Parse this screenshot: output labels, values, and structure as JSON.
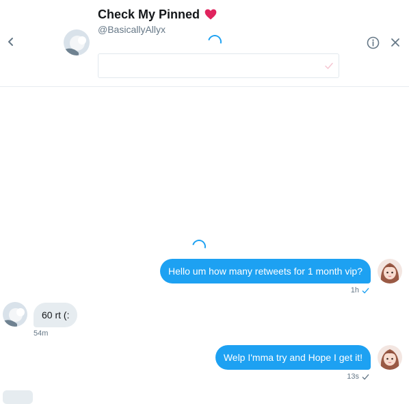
{
  "header": {
    "title": "Check My Pinned",
    "handle": "@BasicallyAllyx",
    "compose": {
      "value": "",
      "placeholder": ""
    }
  },
  "messages": [
    {
      "direction": "sent",
      "text": "Hello um how many retweets for 1 month vip?",
      "time": "1h",
      "read": true
    },
    {
      "direction": "received",
      "text": "60 rt (:",
      "time": "54m"
    },
    {
      "direction": "sent",
      "text": "Welp I'mma try and Hope I get it!",
      "time": "13s",
      "read": true
    }
  ],
  "icons": {
    "back": "chevron-left-icon",
    "heart": "heart-icon",
    "info": "info-icon",
    "close": "close-icon",
    "read_receipt": "check-icon",
    "loading": "spinner-icon"
  },
  "colors": {
    "accent": "#1da1f2",
    "heart": "#e0245e",
    "received_bubble": "#e6ecf0",
    "muted_text": "#657786"
  }
}
